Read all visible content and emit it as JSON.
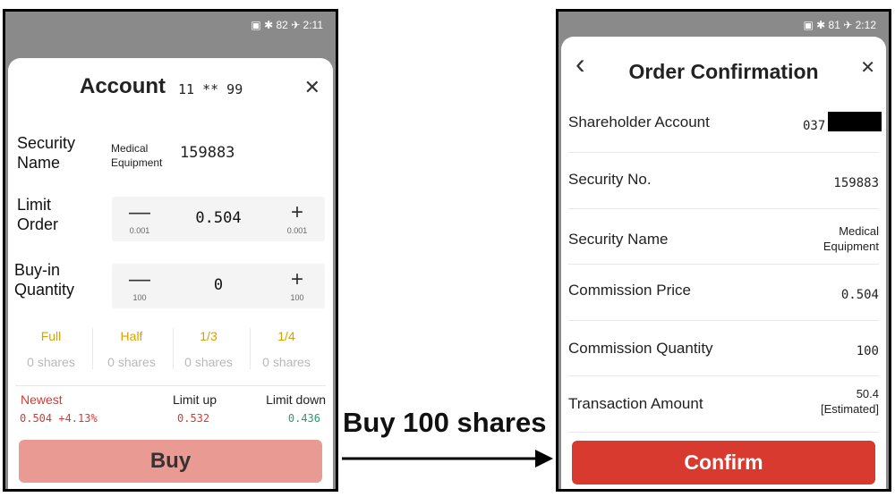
{
  "left": {
    "status": "▣ ✱ 82 ✈ 2:11",
    "title": "Account",
    "account_no": "11 ** 99",
    "close_glyph": "✕",
    "security_name_label": "Security Name",
    "security_name_value": "Medical Equipment",
    "security_code": "159883",
    "limit_order_label": "Limit Order",
    "limit_price": "0.504",
    "price_step": "0.001",
    "buy_qty_label": "Buy-in Quantity",
    "buy_qty": "0",
    "qty_step": "100",
    "minus_glyph": "—",
    "plus_glyph": "+",
    "fractions": [
      {
        "label": "Full",
        "shares": "0 shares"
      },
      {
        "label": "Half",
        "shares": "0 shares"
      },
      {
        "label": "1/3",
        "shares": "0 shares"
      },
      {
        "label": "1/4",
        "shares": "0 shares"
      }
    ],
    "newest_label": "Newest",
    "newest_value": "0.504 +4.13%",
    "limit_up_label": "Limit up",
    "limit_up_value": "0.532",
    "limit_down_label": "Limit down",
    "limit_down_value": "0.436",
    "buy_button": "Buy"
  },
  "arrow_caption": "Buy 100 shares",
  "right": {
    "status": "▣ ✱ 81 ✈ 2:12",
    "back_glyph": "‹",
    "title": "Order Confirmation",
    "close_glyph": "✕",
    "rows": [
      {
        "label": "Shareholder Account",
        "value": "037"
      },
      {
        "label": "Security No.",
        "value": "159883"
      },
      {
        "label": "Security Name",
        "value": "Medical Equipment"
      },
      {
        "label": "Commission Price",
        "value": "0.504"
      },
      {
        "label": "Commission Quantity",
        "value": "100"
      },
      {
        "label": "Transaction Amount",
        "value": "50.4",
        "value2": "[Estimated]"
      }
    ],
    "confirm_button": "Confirm"
  },
  "colors": {
    "buy_button_bg": "#e99a93",
    "confirm_button_bg": "#d93a2f",
    "fraction_text": "#d8a000",
    "up_red": "#d93a2f",
    "down_green": "#2e9a6b"
  }
}
